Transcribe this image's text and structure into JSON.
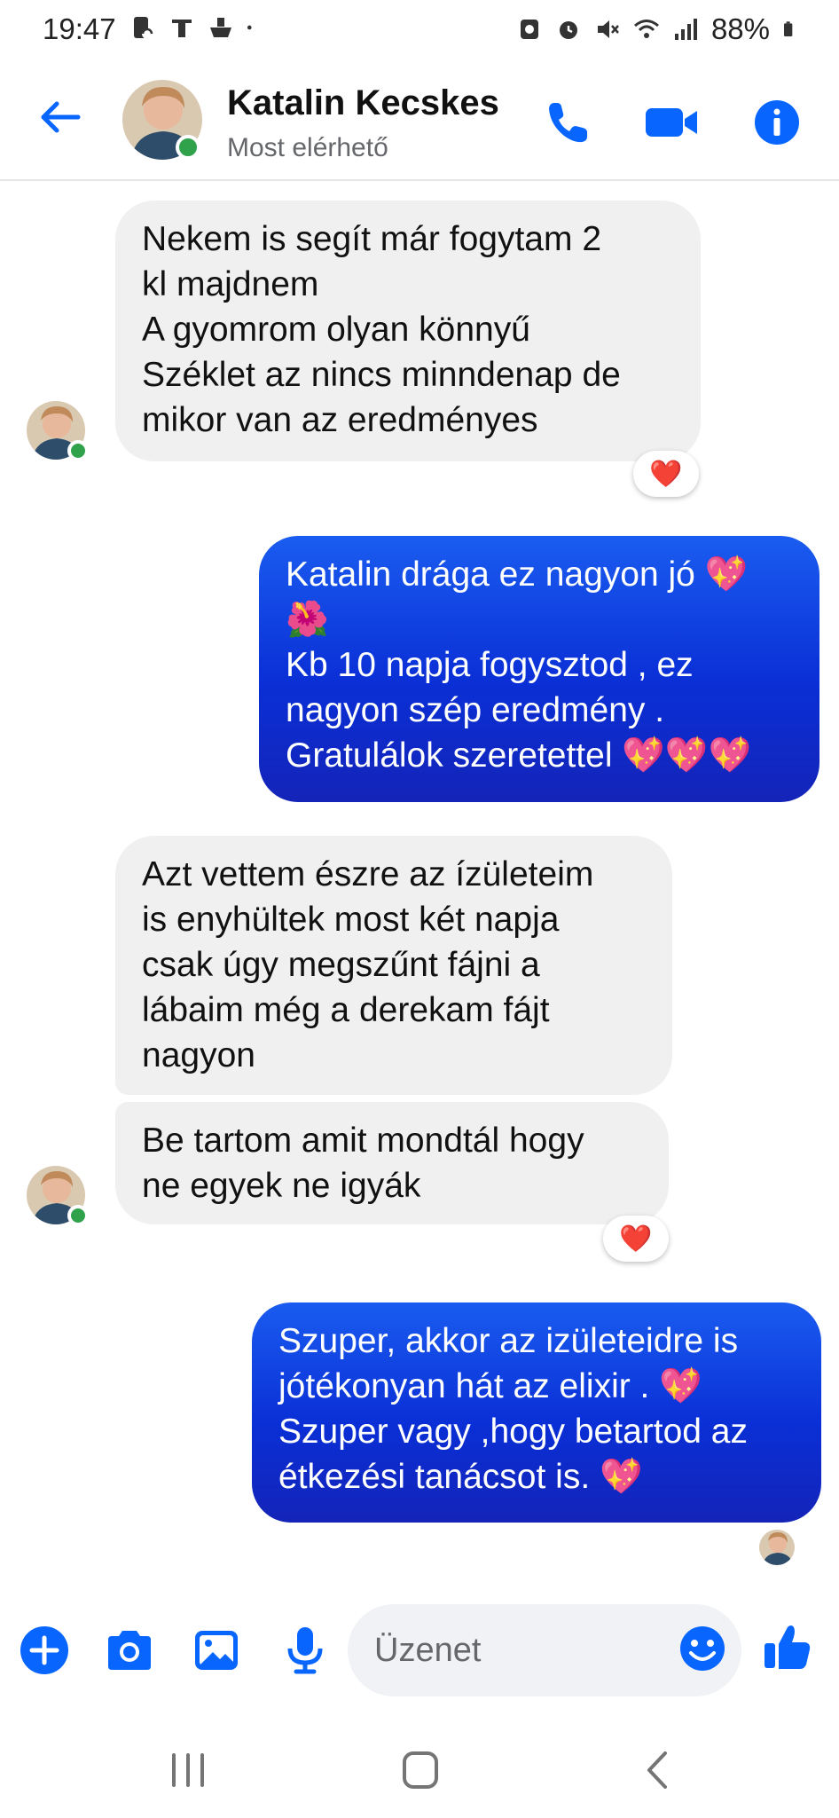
{
  "status_bar": {
    "time": "19:47",
    "battery": "88%",
    "left_icons": [
      "sim-wifi-icon",
      "notification-icon",
      "ship-icon",
      "dot-icon"
    ],
    "right_icons": [
      "app-icon",
      "alarm-icon",
      "mute-icon",
      "wifi-icon",
      "signal-icon",
      "battery-icon"
    ]
  },
  "header": {
    "contact_name": "Katalin Kecskes",
    "contact_status": "Most elérhető",
    "accent_color": "#0866ff"
  },
  "messages": [
    {
      "direction": "incoming",
      "text": "Nekem is segít már fogytam 2\nkl majdnem\nA gyomrom olyan könnyű\nSzéklet az nincs minndenap de\nmikor van az eredményes",
      "reaction": "❤️"
    },
    {
      "direction": "outgoing",
      "text": "Katalin drága ez nagyon jó 💖\n🌺\nKb 10 napja fogysztod , ez\nnagyon szép eredmény .\nGratulálok szeretettel 💖💖💖"
    },
    {
      "direction": "incoming",
      "text": "Azt vettem észre az ízületeim\nis enyhültek most két napja\ncsak úgy megszűnt fájni a\nlábaim még a derekam fájt\nnagyon"
    },
    {
      "direction": "incoming",
      "text": "Be tartom amit mondtál hogy\nne egyek ne igyák",
      "reaction": "❤️"
    },
    {
      "direction": "outgoing",
      "text": "Szuper, akkor az izületeidre is\njótékonyan hát az elixir . 💖\nSzuper vagy ,hogy betartod az\nétkezési tanácsot is. 💖"
    }
  ],
  "composer": {
    "placeholder": "Üzenet"
  },
  "nav": {
    "buttons": [
      "recent-apps-icon",
      "home-icon",
      "back-nav-icon"
    ]
  }
}
